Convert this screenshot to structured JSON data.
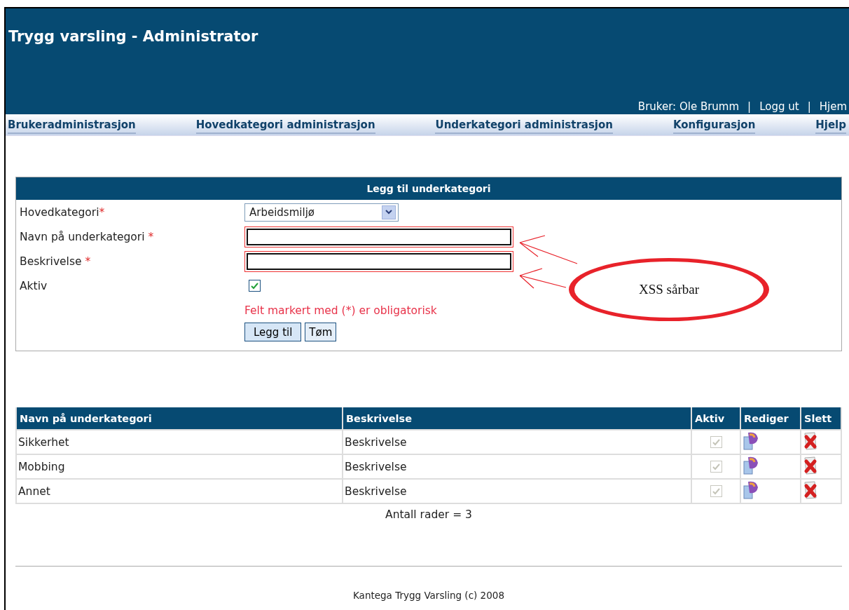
{
  "header": {
    "title": "Trygg varsling - Administrator",
    "user_links": [
      "Bruker: Ole Brumm",
      "|",
      "Logg ut",
      "|",
      "Hjem"
    ]
  },
  "nav": [
    {
      "label": "Brukeradministrasjon"
    },
    {
      "label": "Hovedkategori administrasjon"
    },
    {
      "label": "Underkategori administrasjon"
    },
    {
      "label": "Konfigurasjon"
    },
    {
      "label": "Hjelp"
    }
  ],
  "form": {
    "title": "Legg til underkategori",
    "fields": [
      {
        "kind": "select",
        "label": "Hovedkategori",
        "marker": "*",
        "value": "Arbeidsmiljø"
      },
      {
        "kind": "text",
        "label": "Navn på underkategori",
        "marker": "*",
        "highlighted": true
      },
      {
        "kind": "text",
        "label": "Beskrivelse",
        "marker": "*",
        "highlighted": true
      },
      {
        "kind": "checkbox",
        "label": "Aktiv",
        "checked": true
      }
    ],
    "note": "Felt markert med (*) er obligatorisk",
    "buttons": [
      {
        "label": "Legg til",
        "primary": true
      },
      {
        "label": "Tøm",
        "primary": false
      }
    ]
  },
  "annotation": {
    "text": "XSS sårbar"
  },
  "table": {
    "columns": [
      "Navn på underkategori",
      "Beskrivelse",
      "Aktiv",
      "Rediger",
      "Slett"
    ],
    "rows": [
      {
        "name": "Sikkerhet",
        "description": "Beskrivelse",
        "active": true
      },
      {
        "name": "Mobbing",
        "description": "Beskrivelse",
        "active": true
      },
      {
        "name": "Annet",
        "description": "Beskrivelse",
        "active": true
      }
    ],
    "row_count": "Antall rader = 3"
  },
  "footer": "Kantega Trygg Varsling (c) 2008"
}
